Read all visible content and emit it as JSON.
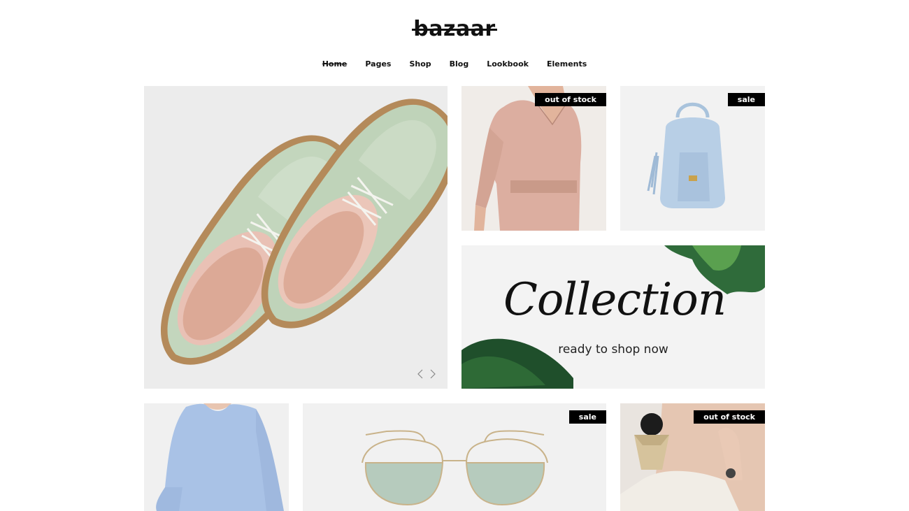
{
  "site": {
    "logo": "bazaar"
  },
  "nav": {
    "items": [
      {
        "label": "Home",
        "active": true
      },
      {
        "label": "Pages"
      },
      {
        "label": "Shop"
      },
      {
        "label": "Blog"
      },
      {
        "label": "Lookbook"
      },
      {
        "label": "Elements"
      }
    ]
  },
  "tiles": {
    "shoes": {
      "image": "metallic green leather oxford shoes"
    },
    "dress": {
      "image": "pink blouse dress",
      "badge": "out of stock"
    },
    "backpack": {
      "image": "light blue leather backpack",
      "badge": "sale"
    },
    "collection": {
      "title": "Collection",
      "subtitle": "ready to shop now",
      "image": "monstera leaves"
    },
    "sweater": {
      "image": "light blue knit sweater"
    },
    "sunglasses": {
      "image": "aviator sunglasses with green lenses",
      "badge": "sale"
    },
    "earrings": {
      "image": "woman wearing fringe earrings",
      "badge": "out of stock"
    }
  },
  "slider": {
    "prev_icon": "chevron-left-icon",
    "next_icon": "chevron-right-icon"
  },
  "colors": {
    "badge_bg": "#000000",
    "badge_text": "#ffffff",
    "text": "#111111"
  }
}
